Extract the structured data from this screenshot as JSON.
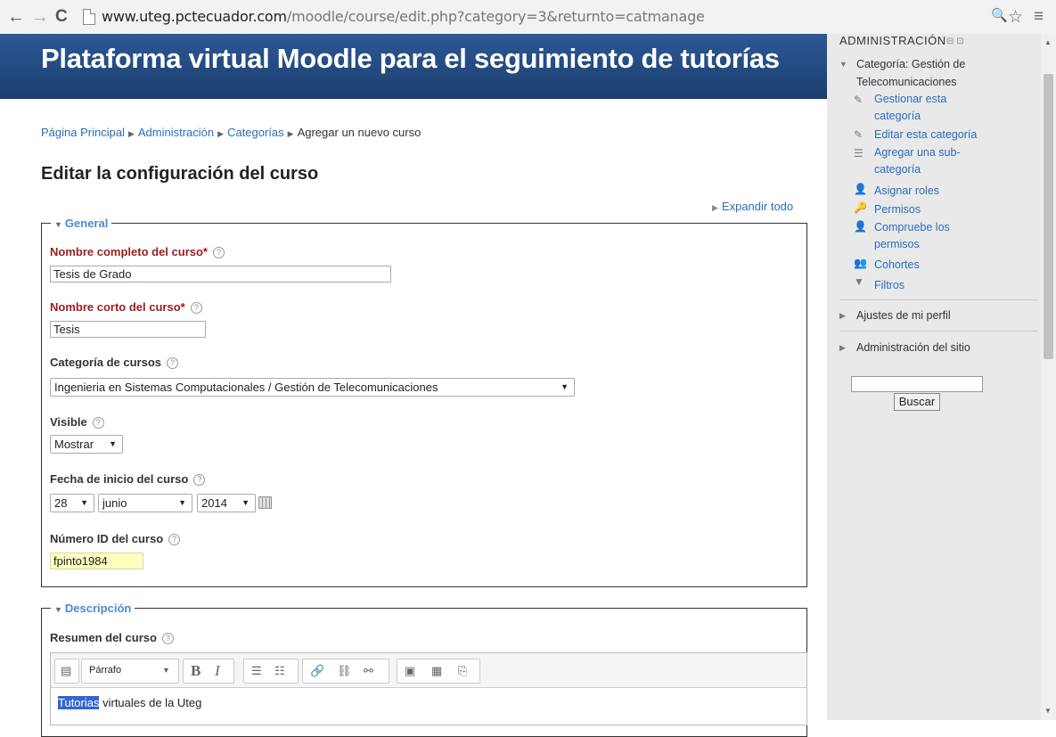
{
  "browser": {
    "back": "←",
    "forward": "→",
    "reload": "C",
    "url_host": "www.uteg.pctecuador.com",
    "url_path": "/moodle/course/edit.php?category=3&returnto=catmanage",
    "zoom": "🔍",
    "star": "☆",
    "menu": "≡"
  },
  "header": {
    "title": "Plataforma virtual Moodle para el seguimiento de tutorías"
  },
  "breadcrumb": [
    "Página Principal",
    "Administración",
    "Categorías",
    "Agregar un nuevo curso"
  ],
  "page_title": "Editar la configuración del curso",
  "expand_all": "Expandir todo",
  "general": {
    "legend": "General",
    "fullname_label": "Nombre completo del curso",
    "fullname_value": "Tesis de Grado",
    "shortname_label": "Nombre corto del curso",
    "shortname_value": "Tesis",
    "category_label": "Categoría de cursos",
    "category_value": "Ingenieria en Sistemas Computacionales / Gestión de Telecomunicaciones",
    "visible_label": "Visible",
    "visible_value": "Mostrar",
    "startdate_label": "Fecha de inicio del curso",
    "day": "28",
    "month": "junio",
    "year": "2014",
    "idnumber_label": "Número ID del curso",
    "idnumber_value": "fpinto1984",
    "required_mark": "*",
    "help": "?"
  },
  "description": {
    "legend": "Descripción",
    "summary_label": "Resumen del curso",
    "format": "Párrafo",
    "text_highlight": "Tutorias",
    "text_rest": " virtuales de la Uteg"
  },
  "sidebar": {
    "title": "ADMINISTRACIÓN",
    "category_node": "Categoría: Gestión de Telecomunicaciones",
    "links": [
      "Gestionar esta categoría",
      "Editar esta categoría",
      "Agregar una sub-categoría",
      "Asignar roles",
      "Permisos",
      "Compruebe los permisos",
      "Cohortes",
      "Filtros"
    ],
    "profile": "Ajustes de mi perfil",
    "site_admin": "Administración del sitio",
    "search_button": "Buscar"
  }
}
